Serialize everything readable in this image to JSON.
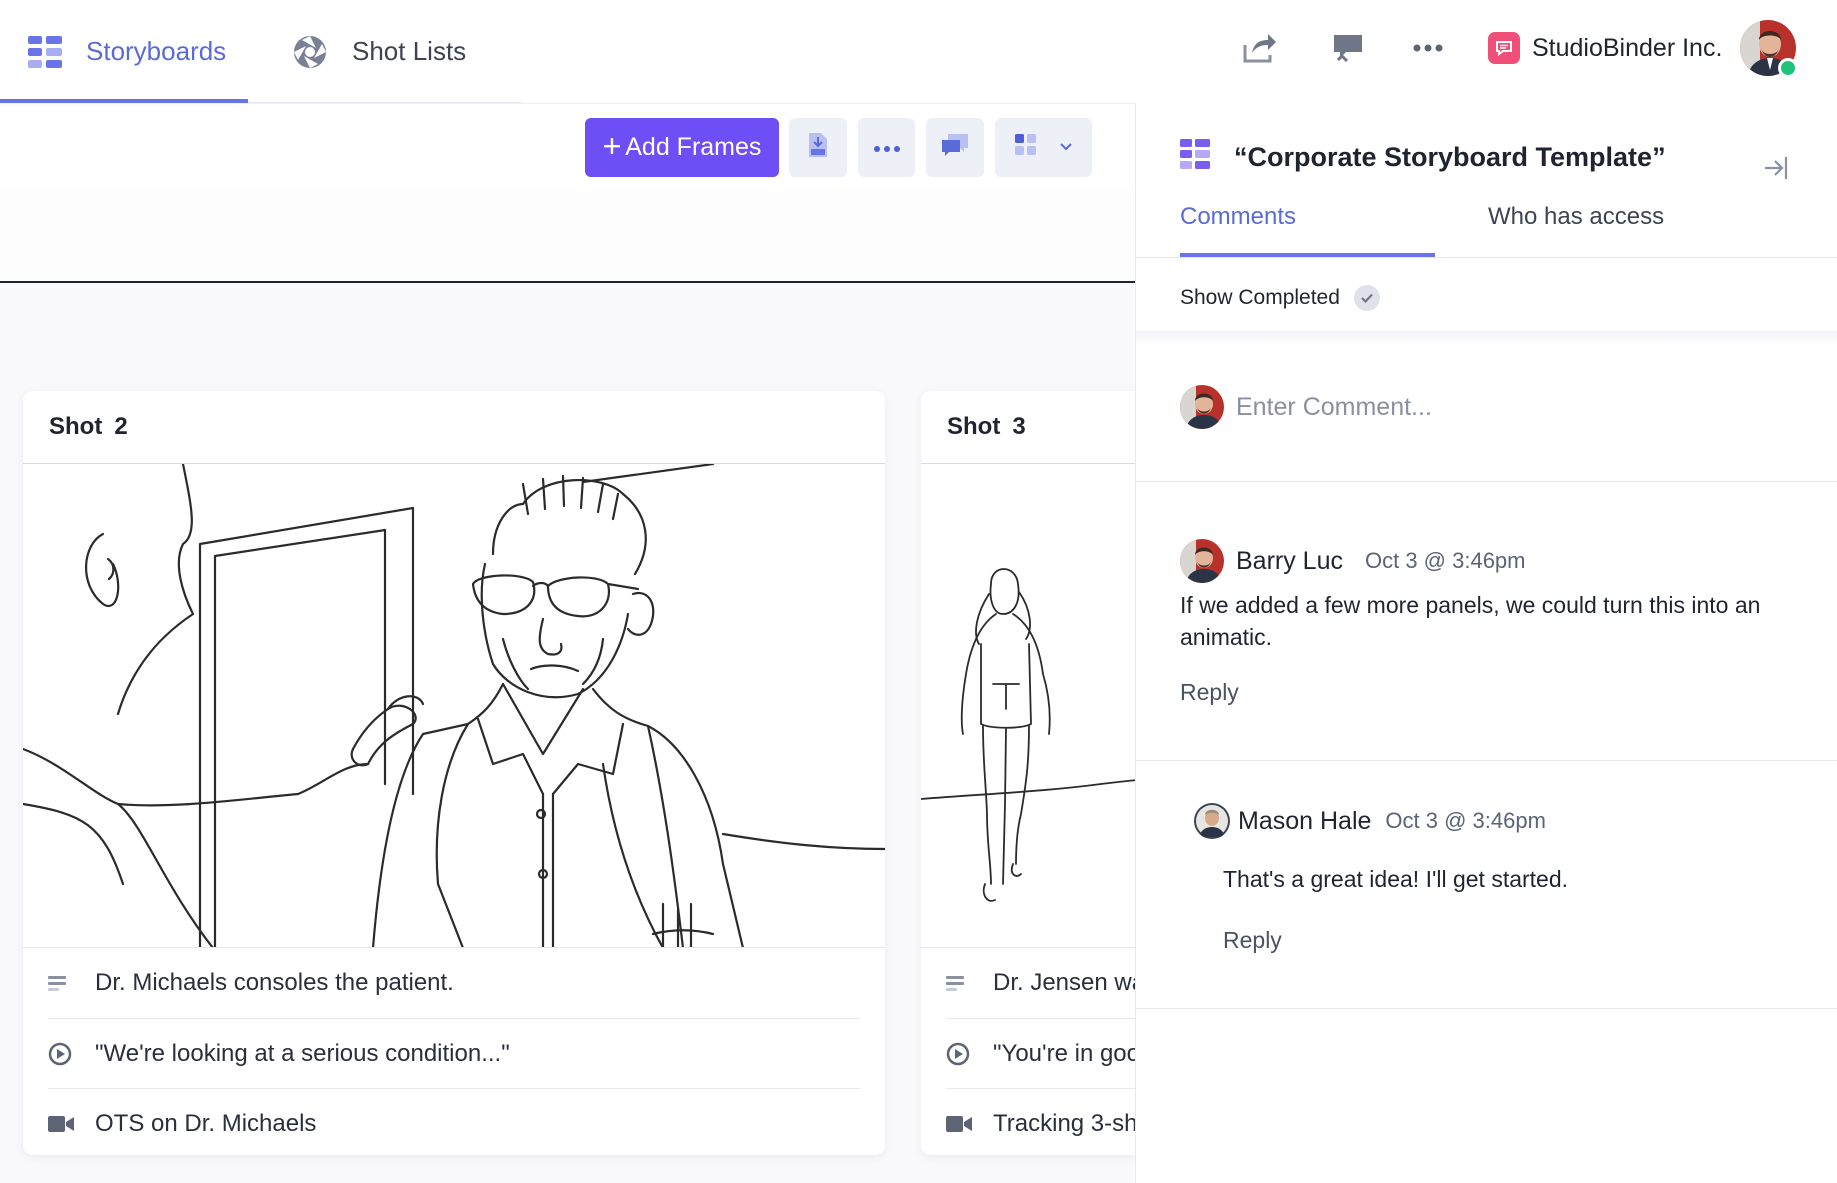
{
  "nav": {
    "tabs": [
      {
        "label": "Storyboards",
        "icon": "storyboard-grid-icon",
        "active": true
      },
      {
        "label": "Shot Lists",
        "icon": "aperture-icon",
        "active": false
      }
    ],
    "icons": [
      "share-icon",
      "present-icon",
      "more-icon"
    ],
    "org_name": "StudioBinder Inc.",
    "org_logo_icon": "chat-bubble-icon",
    "user_online": true
  },
  "toolbar": {
    "add_frames_label": "Add Frames",
    "buttons": [
      "pdf-download-icon",
      "more-icon",
      "comments-icon",
      "layout-grid-icon",
      "chevron-down-icon"
    ]
  },
  "shots": [
    {
      "label": "Shot",
      "number": "2",
      "description": "Dr. Michaels consoles the patient.",
      "dialogue": "\"We're looking at a serious condition...\"",
      "camera": "OTS on Dr. Michaels"
    },
    {
      "label": "Shot",
      "number": "3",
      "description": "Dr. Jensen wa",
      "dialogue": "\"You're in goo",
      "camera": "Tracking 3-sh"
    }
  ],
  "panel": {
    "title": "“Corporate Storyboard Template”",
    "tabs": [
      "Comments",
      "Who has access"
    ],
    "show_completed_label": "Show Completed",
    "comment_placeholder": "Enter Comment...",
    "comments": [
      {
        "author": "Barry Luc",
        "time": "Oct 3 @ 3:46pm",
        "text": "If we added a few more panels, we could turn this into an animatic.",
        "reply_label": "Reply"
      },
      {
        "author": "Mason Hale",
        "time": "Oct 3 @ 3:46pm",
        "text": "That's a great idea! I'll get started.",
        "reply_label": "Reply"
      }
    ]
  },
  "colors": {
    "accent": "#6d4ff5",
    "tab_active": "#5a6ad8",
    "online": "#1fc47c",
    "brand_logo": "#ef4f79"
  }
}
